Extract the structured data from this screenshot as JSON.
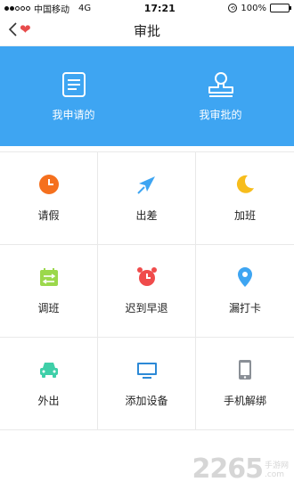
{
  "status": {
    "carrier": "中国移动",
    "network": "4G",
    "time": "17:21",
    "battery": "100%"
  },
  "nav": {
    "title": "审批"
  },
  "banner": {
    "mine_label": "我申请的",
    "approve_label": "我审批的"
  },
  "grid": {
    "items": [
      {
        "label": "请假",
        "icon": "clock-icon",
        "color": "#f5701e"
      },
      {
        "label": "出差",
        "icon": "airplane-icon",
        "color": "#3ea5f2"
      },
      {
        "label": "加班",
        "icon": "moon-icon",
        "color": "#f7bd1c"
      },
      {
        "label": "调班",
        "icon": "calendar-swap-icon",
        "color": "#9bd84b"
      },
      {
        "label": "迟到早退",
        "icon": "alarm-clock-icon",
        "color": "#f04b4b"
      },
      {
        "label": "漏打卡",
        "icon": "location-pin-icon",
        "color": "#3ea5f2"
      },
      {
        "label": "外出",
        "icon": "car-icon",
        "color": "#3fcfa8"
      },
      {
        "label": "添加设备",
        "icon": "monitor-icon",
        "color": "#2c89d6"
      },
      {
        "label": "手机解绑",
        "icon": "phone-icon",
        "color": "#8a8f96"
      }
    ]
  },
  "watermark": {
    "number": "2265",
    "suffix": "手游网",
    "domain": ".com"
  }
}
